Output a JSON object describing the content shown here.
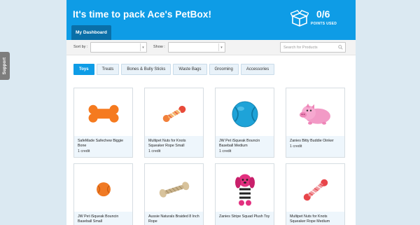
{
  "support_tab": {
    "label": "Support"
  },
  "header": {
    "title": "It's time to pack Ace's PetBox!",
    "dashboard_tab": "My Dashboard",
    "points_count": "0/6",
    "points_label": "POINTS USED"
  },
  "toolbar": {
    "sort_label": "Sort by :",
    "sort_value": "",
    "show_label": "Show :",
    "show_value": "",
    "search_placeholder": "Search for Products"
  },
  "categories": [
    "Toys",
    "Treats",
    "Bones & Bully Sticks",
    "Waste Bags",
    "Grooming",
    "Accessories"
  ],
  "active_category": "Toys",
  "products": [
    {
      "name": "SafeMade Safechew Biggie Bone",
      "credit": "1 credit",
      "icon": "orange-bone-toy"
    },
    {
      "name": "Multipet Nuts for Knots Squeaker Rope Small",
      "credit": "1 credit",
      "icon": "rope-toy"
    },
    {
      "name": "JW Pet iSqueak Bouncin Baseball Medium",
      "credit": "1 credit",
      "icon": "blue-ball-toy"
    },
    {
      "name": "Zanies Bitty Buddie Oinker",
      "credit": "1 credit",
      "icon": "pink-pig-plush"
    },
    {
      "name": "JW Pet iSqueak Bouncin Baseball Small",
      "credit": "",
      "icon": "orange-ball-toy"
    },
    {
      "name": "Aussie Naturals Braided 8 Inch Rope",
      "credit": "",
      "icon": "braided-rope-toy"
    },
    {
      "name": "Zanies Stripe Squad Plush Toy",
      "credit": "",
      "icon": "pink-dog-plush"
    },
    {
      "name": "Multipet Nuts for Knots Squeaker Rope Medium",
      "credit": "",
      "icon": "rope-toy"
    }
  ]
}
